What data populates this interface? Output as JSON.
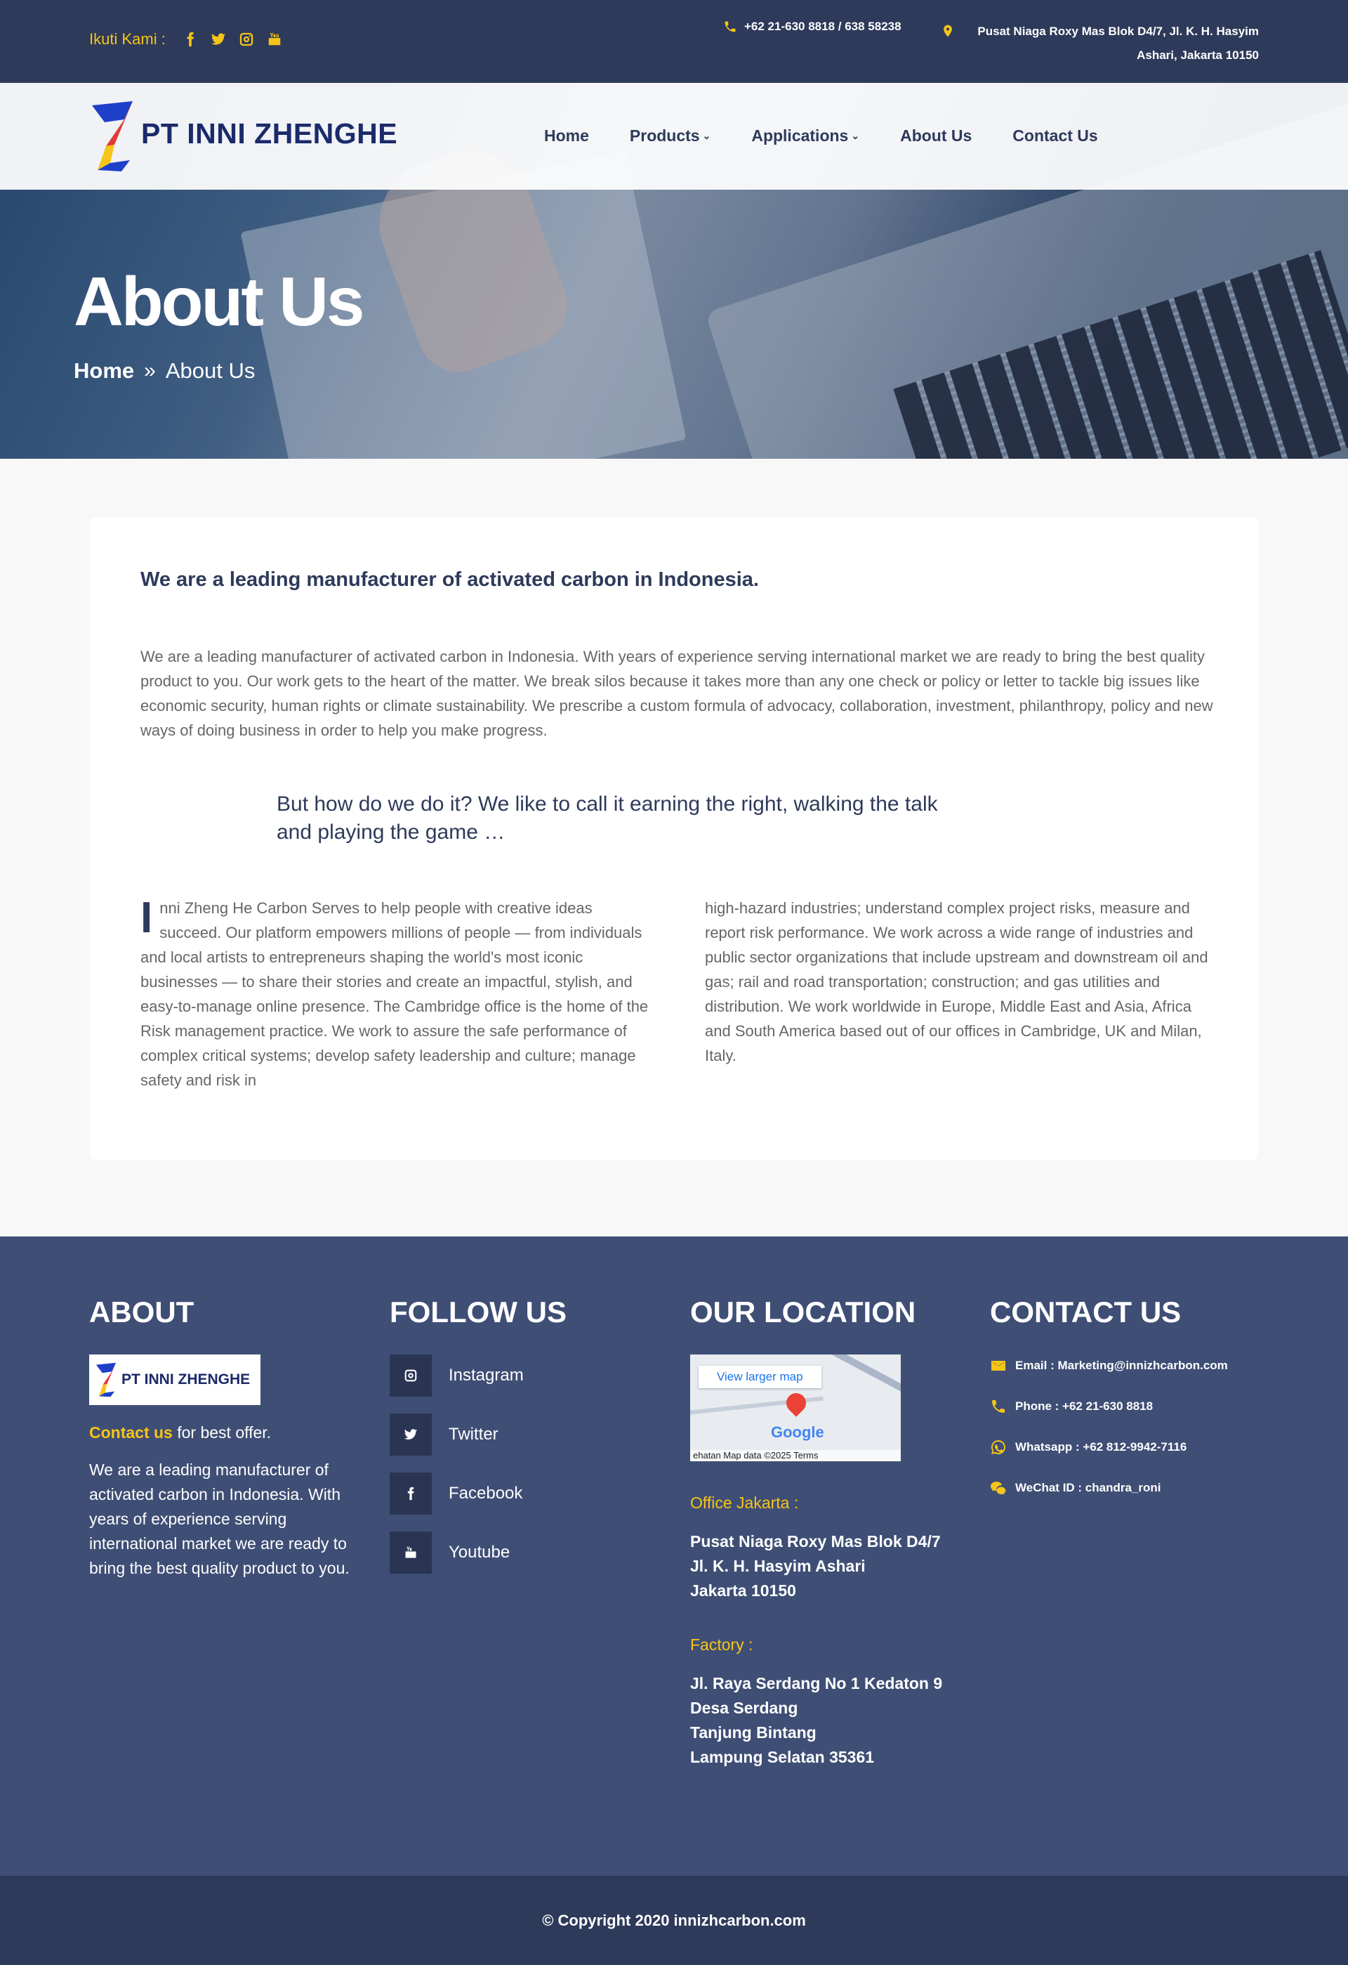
{
  "topbar": {
    "follow_label": "Ikuti Kami :",
    "social_icons": [
      "facebook-icon",
      "twitter-icon",
      "instagram-icon",
      "youtube-icon"
    ],
    "phone": "+62 21-630 8818 / 638 58238",
    "address": "Pusat Niaga Roxy Mas Blok D4/7, Jl. K. H. Hasyim Ashari, Jakarta 10150"
  },
  "brand": {
    "name": "PT INNI ZHENGHE"
  },
  "nav": {
    "items": [
      {
        "label": "Home"
      },
      {
        "label": "Products",
        "chevron": "⌄"
      },
      {
        "label": "Applications",
        "chevron": "⌄"
      },
      {
        "label": "About Us"
      },
      {
        "label": "Contact Us"
      }
    ]
  },
  "hero": {
    "title": "About Us",
    "breadcrumb": {
      "home": "Home",
      "separator": "»",
      "current": "About Us"
    }
  },
  "content": {
    "lead": "We are a leading manufacturer of activated carbon in Indonesia.",
    "intro": "We are a leading manufacturer of activated carbon in Indonesia. With years of experience serving international market we are ready to bring the best quality product to you. Our work gets to the heart of the matter. We break silos because it takes more than any one check or policy or letter to tackle big issues like economic security, human rights or climate sustainability. We prescribe a custom formula of advocacy, collaboration, investment, philanthropy, policy and new ways of doing business in order to help you make progress.",
    "quote": "But how do we do it? We like to call it earning the right, walking the talk and playing the game …",
    "dropcap": "I",
    "col1": "nni Zheng He Carbon Serves to help people with creative ideas succeed. Our platform empowers millions of people — from individuals and local artists to entrepreneurs shaping the world's most iconic businesses — to share their stories and create an impactful, stylish, and easy-to-manage online presence. The Cambridge office is the home of the Risk management practice. We work to assure the safe performance of complex critical systems; develop safety leadership and culture; manage safety and risk in",
    "col2": "high-hazard industries; understand complex project risks, measure and report risk performance. We work across a wide range of industries and public sector organizations that include upstream and downstream oil and gas; rail and road transportation; construction; and gas utilities and distribution. We work worldwide in Europe, Middle East and Asia, Africa and South America based out of our offices in Cambridge, UK and Milan, Italy."
  },
  "footer": {
    "about": {
      "heading": "ABOUT",
      "logo_text": "PT INNI ZHENGHE",
      "offer_link": "Contact us",
      "offer_rest": " for best offer.",
      "text": "We are a leading manufacturer of activated carbon in Indonesia. With years of experience serving international market we are ready to bring the best quality product to you."
    },
    "follow": {
      "heading": "FOLLOW US",
      "items": [
        {
          "label": "Instagram",
          "icon": "instagram-icon"
        },
        {
          "label": "Twitter",
          "icon": "twitter-icon"
        },
        {
          "label": "Facebook",
          "icon": "facebook-icon"
        },
        {
          "label": "Youtube",
          "icon": "youtube-icon"
        }
      ]
    },
    "location": {
      "heading": "OUR LOCATION",
      "map_button": "View larger map",
      "map_brand": "Google",
      "map_footer": "ehatan   Map data ©2025   Terms",
      "office_label": "Office Jakarta :",
      "office_lines": [
        "Pusat Niaga Roxy Mas Blok D4/7",
        "Jl. K. H. Hasyim Ashari",
        "Jakarta 10150"
      ],
      "factory_label": "Factory :",
      "factory_lines": [
        "Jl. Raya Serdang No 1 Kedaton 9",
        "Desa Serdang",
        "Tanjung Bintang",
        "Lampung Selatan 35361"
      ]
    },
    "contact": {
      "heading": "CONTACT US",
      "email": "Email : Marketing@innizhcarbon.com",
      "phone": "Phone : +62 21-630 8818",
      "whatsapp": "Whatsapp : +62 812-9942-7116",
      "wechat": "WeChat ID : chandra_roni"
    }
  },
  "copyright": "© Copyright 2020 innizhcarbon.com",
  "colors": {
    "navy": "#2e3a5a",
    "footer": "#3f4e75",
    "accent": "#f5c518"
  }
}
